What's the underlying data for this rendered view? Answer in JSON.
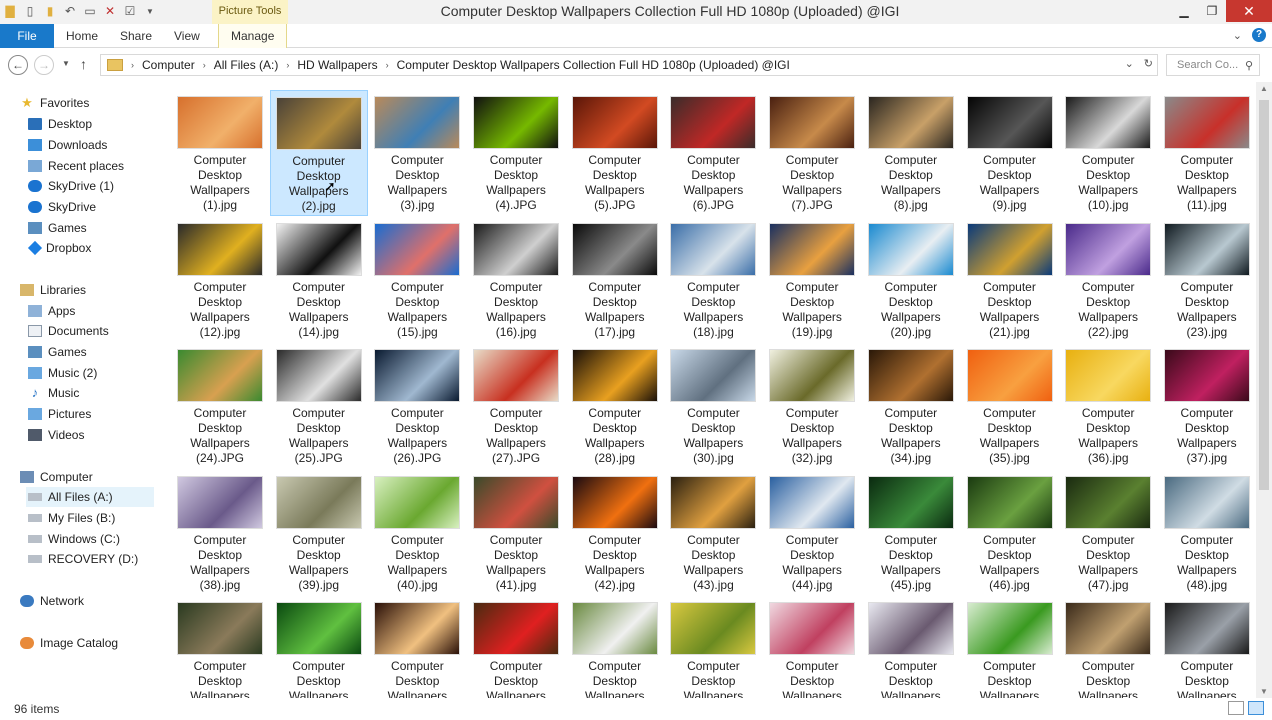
{
  "window": {
    "title": "Computer Desktop Wallpapers Collection Full HD 1080p (Uploaded) @IGI",
    "context_tab": "Picture Tools",
    "minimize_icon": "minimize-icon",
    "maximize_icon": "restore-icon",
    "close_icon": "close-icon"
  },
  "ribbon": {
    "file": "File",
    "home": "Home",
    "share": "Share",
    "view": "View",
    "manage": "Manage",
    "accent": "#1979ca"
  },
  "address": {
    "crumbs": [
      "Computer",
      "All Files (A:)",
      "HD Wallpapers",
      "Computer Desktop Wallpapers Collection Full HD 1080p (Uploaded) @IGI"
    ],
    "search_placeholder": "Search Co..."
  },
  "sidebar": {
    "favorites_header": "Favorites",
    "favorites": [
      "Desktop",
      "Downloads",
      "Recent places",
      "SkyDrive (1)",
      "SkyDrive",
      "Games",
      "Dropbox"
    ],
    "libraries_header": "Libraries",
    "libraries": [
      "Apps",
      "Documents",
      "Games",
      "Music (2)",
      "Music",
      "Pictures",
      "Videos"
    ],
    "computer_header": "Computer",
    "drives": [
      "All Files (A:)",
      "My Files (B:)",
      "Windows (C:)",
      "RECOVERY (D:)"
    ],
    "network": "Network",
    "image_catalog": "Image Catalog"
  },
  "files": [
    {
      "name": "Computer Desktop Wallpapers (1).jpg",
      "color": "#d7702d",
      "color2": "#f1b06a"
    },
    {
      "name": "Computer Desktop Wallpapers (2).jpg",
      "color": "#4a4238",
      "color2": "#b08a3c",
      "selected": true
    },
    {
      "name": "Computer Desktop Wallpapers (3).jpg",
      "color": "#b98a5a",
      "color2": "#3f7fb5"
    },
    {
      "name": "Computer Desktop Wallpapers (4).JPG",
      "color": "#101010",
      "color2": "#76b900"
    },
    {
      "name": "Computer Desktop Wallpapers (5).JPG",
      "color": "#5a1608",
      "color2": "#d24a22"
    },
    {
      "name": "Computer Desktop Wallpapers (6).JPG",
      "color": "#3a2c2a",
      "color2": "#c02826"
    },
    {
      "name": "Computer Desktop Wallpapers (7).JPG",
      "color": "#4a2010",
      "color2": "#c78a4a"
    },
    {
      "name": "Computer Desktop Wallpapers (8).jpg",
      "color": "#2a2620",
      "color2": "#c8a068"
    },
    {
      "name": "Computer Desktop Wallpapers (9).jpg",
      "color": "#050505",
      "color2": "#565656"
    },
    {
      "name": "Computer Desktop Wallpapers (10).jpg",
      "color": "#1a1a1a",
      "color2": "#d8d8d8"
    },
    {
      "name": "Computer Desktop Wallpapers (11).jpg",
      "color": "#8a8a8a",
      "color2": "#c8302a"
    },
    {
      "name": "Computer Desktop Wallpapers (12).jpg",
      "color": "#2a2a2a",
      "color2": "#e0b020"
    },
    {
      "name": "Computer Desktop Wallpapers (14).jpg",
      "color": "#f2f2f2",
      "color2": "#101010"
    },
    {
      "name": "Computer Desktop Wallpapers (15).jpg",
      "color": "#1a6cd0",
      "color2": "#e0706a"
    },
    {
      "name": "Computer Desktop Wallpapers (16).jpg",
      "color": "#1a1a1a",
      "color2": "#cfcfcf"
    },
    {
      "name": "Computer Desktop Wallpapers (17).jpg",
      "color": "#0a0a0a",
      "color2": "#8a8a8a"
    },
    {
      "name": "Computer Desktop Wallpapers (18).jpg",
      "color": "#3a6ea8",
      "color2": "#d8e2ea"
    },
    {
      "name": "Computer Desktop Wallpapers (19).jpg",
      "color": "#1a3060",
      "color2": "#e8a040"
    },
    {
      "name": "Computer Desktop Wallpapers (20).jpg",
      "color": "#1a8ad0",
      "color2": "#e8eef2"
    },
    {
      "name": "Computer Desktop Wallpapers (21).jpg",
      "color": "#0a3a7a",
      "color2": "#d0a030"
    },
    {
      "name": "Computer Desktop Wallpapers (22).jpg",
      "color": "#4a2a8a",
      "color2": "#c0a0e0"
    },
    {
      "name": "Computer Desktop Wallpapers (23).jpg",
      "color": "#101a20",
      "color2": "#b8c8d0"
    },
    {
      "name": "Computer Desktop Wallpapers (24).JPG",
      "color": "#3a8a30",
      "color2": "#d8a050"
    },
    {
      "name": "Computer Desktop Wallpapers (25).JPG",
      "color": "#2a2a2a",
      "color2": "#e0e0e0"
    },
    {
      "name": "Computer Desktop Wallpapers (26).JPG",
      "color": "#0a1a30",
      "color2": "#a0b8d0"
    },
    {
      "name": "Computer Desktop Wallpapers (27).JPG",
      "color": "#e8dcc8",
      "color2": "#c83020"
    },
    {
      "name": "Computer Desktop Wallpapers (28).jpg",
      "color": "#1a1008",
      "color2": "#e8a020"
    },
    {
      "name": "Computer Desktop Wallpapers (30).jpg",
      "color": "#c8d8e8",
      "color2": "#607080"
    },
    {
      "name": "Computer Desktop Wallpapers (32).jpg",
      "color": "#f0f0e0",
      "color2": "#6a6a2a"
    },
    {
      "name": "Computer Desktop Wallpapers (34).jpg",
      "color": "#2a1808",
      "color2": "#b07030"
    },
    {
      "name": "Computer Desktop Wallpapers (35).jpg",
      "color": "#f06010",
      "color2": "#f8a040"
    },
    {
      "name": "Computer Desktop Wallpapers (36).jpg",
      "color": "#e8b010",
      "color2": "#f8d860"
    },
    {
      "name": "Computer Desktop Wallpapers (37).jpg",
      "color": "#3a0a1a",
      "color2": "#c02060"
    },
    {
      "name": "Computer Desktop Wallpapers (38).jpg",
      "color": "#d0c8e0",
      "color2": "#6a5a8a"
    },
    {
      "name": "Computer Desktop Wallpapers (39).jpg",
      "color": "#c8c8b0",
      "color2": "#7a7a5a"
    },
    {
      "name": "Computer Desktop Wallpapers (40).jpg",
      "color": "#d8f0c0",
      "color2": "#6aa830"
    },
    {
      "name": "Computer Desktop Wallpapers (41).jpg",
      "color": "#3a4a2a",
      "color2": "#d05040"
    },
    {
      "name": "Computer Desktop Wallpapers (42).jpg",
      "color": "#1a0a10",
      "color2": "#f07010"
    },
    {
      "name": "Computer Desktop Wallpapers (43).jpg",
      "color": "#2a2010",
      "color2": "#e0a040"
    },
    {
      "name": "Computer Desktop Wallpapers (44).jpg",
      "color": "#2a60a0",
      "color2": "#e0e8f0"
    },
    {
      "name": "Computer Desktop Wallpapers (45).jpg",
      "color": "#0a2a10",
      "color2": "#3a8a3a"
    },
    {
      "name": "Computer Desktop Wallpapers (46).jpg",
      "color": "#1a3a10",
      "color2": "#6aa040"
    },
    {
      "name": "Computer Desktop Wallpapers (47).jpg",
      "color": "#1a2a10",
      "color2": "#5a8030"
    },
    {
      "name": "Computer Desktop Wallpapers (48).jpg",
      "color": "#4a6a80",
      "color2": "#d0dce4"
    },
    {
      "name": "Computer Desktop Wallpapers",
      "color": "#2a3a20",
      "color2": "#8a7a5a"
    },
    {
      "name": "Computer Desktop Wallpapers",
      "color": "#0a4a10",
      "color2": "#60c040"
    },
    {
      "name": "Computer Desktop Wallpapers",
      "color": "#2a1008",
      "color2": "#f0c080"
    },
    {
      "name": "Computer Desktop Wallpapers",
      "color": "#4a2a10",
      "color2": "#e02020"
    },
    {
      "name": "Computer Desktop Wallpapers",
      "color": "#6a8a40",
      "color2": "#f0f0f0"
    },
    {
      "name": "Computer Desktop Wallpapers",
      "color": "#d8c840",
      "color2": "#6a8a20"
    },
    {
      "name": "Computer Desktop Wallpapers",
      "color": "#f0d8e0",
      "color2": "#c04060"
    },
    {
      "name": "Computer Desktop Wallpapers",
      "color": "#e8e8f0",
      "color2": "#6a5a70"
    },
    {
      "name": "Computer Desktop Wallpapers",
      "color": "#d8ecd0",
      "color2": "#3a9a20"
    },
    {
      "name": "Computer Desktop Wallpapers",
      "color": "#3a2a1a",
      "color2": "#c0a070"
    },
    {
      "name": "Computer Desktop Wallpapers",
      "color": "#1a1a1a",
      "color2": "#9aa0a8"
    }
  ],
  "status": {
    "count": "96 items"
  }
}
